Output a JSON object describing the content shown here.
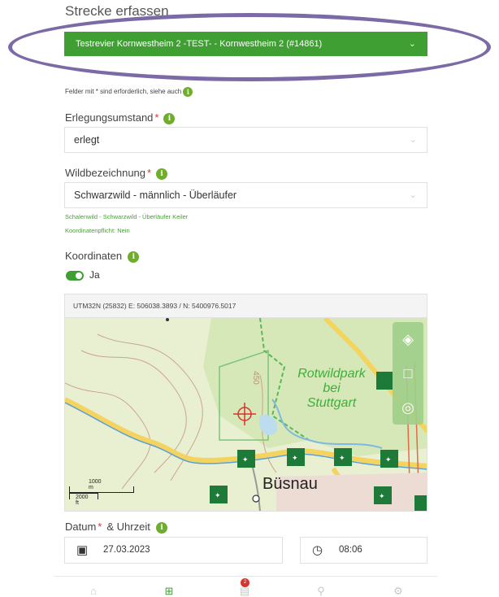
{
  "page": {
    "title": "Strecke erfassen"
  },
  "revier": {
    "value": "Testrevier Kornwestheim 2 -TEST- - Kornwestheim 2 (#14861)"
  },
  "form": {
    "required_note": "Felder mit * sind erforderlich, siehe auch",
    "required_marker": "*",
    "info_symbol": "i",
    "erlegungsumstand": {
      "label": "Erlegungsumstand",
      "value": "erlegt"
    },
    "wildbezeichnung": {
      "label": "Wildbezeichnung",
      "value": "Schwarzwild - männlich - Überläufer",
      "hint_category": "Schalenwild - Schwarzwild - Überläufer Keiler",
      "hint_coord": "Koordinatenpflicht: Nein"
    },
    "koordinaten": {
      "label": "Koordinaten",
      "toggle_on": true,
      "toggle_label": "Ja",
      "readout": "UTM32N (25832) E: 506038.3893 / N: 5400976.5017"
    },
    "datum": {
      "label_date": "Datum",
      "label_time": "& Uhrzeit",
      "date": "27.03.2023",
      "time": "08:06"
    }
  },
  "map": {
    "labels": {
      "park": [
        "Rotwildpark",
        "bei",
        "Stuttgart"
      ],
      "town": "Büsnau",
      "contour": "450"
    },
    "scale": {
      "metric": "1000 m",
      "imperial": "2000 ft"
    },
    "controls": [
      "layers-icon",
      "lock-icon",
      "locate-icon"
    ]
  },
  "nav": {
    "items": [
      "home-icon",
      "add-icon",
      "list-icon",
      "location-icon",
      "settings-icon"
    ],
    "badge": "2"
  },
  "colors": {
    "accent": "#3f9f33",
    "info": "#6fae2d",
    "annotation": "#7b6aa6",
    "required": "#d33333"
  }
}
